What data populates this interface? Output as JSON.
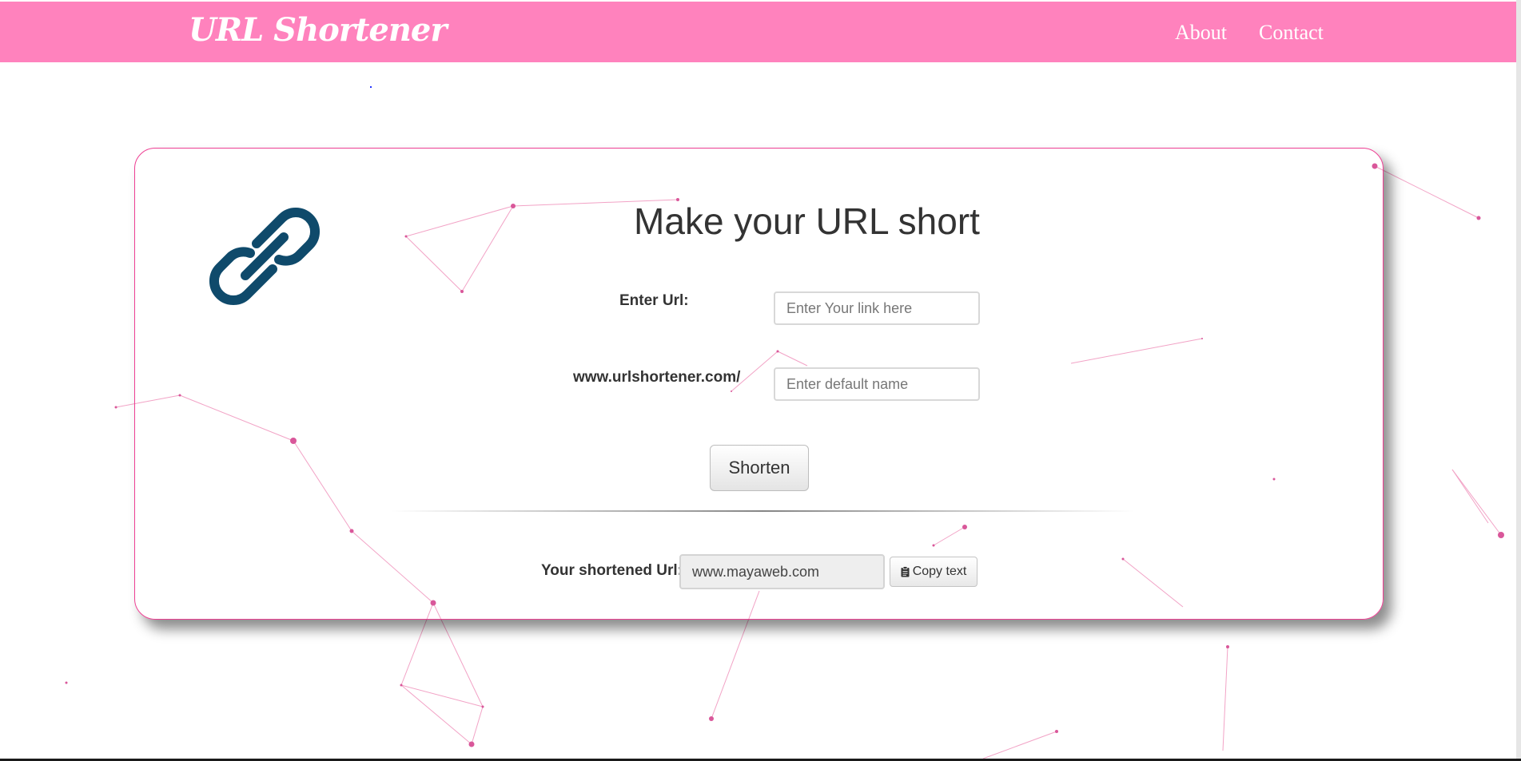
{
  "navbar": {
    "brand": "URL Shortener",
    "links": [
      {
        "label": "About"
      },
      {
        "label": "Contact"
      }
    ],
    "color": "#ff82bd"
  },
  "card": {
    "border_color": "#ee3f93",
    "icon": "link-chain-icon",
    "icon_color": "#0f4a6b",
    "title": "Make your URL short",
    "url_label": "Enter Url:",
    "url_placeholder": "Enter Your link here",
    "domain_label": "www.urlshortener.com/",
    "name_placeholder": "Enter default name",
    "shorten_label": "Shorten",
    "result_label": "Your shortened Url:",
    "result_value": "www.mayaweb.com",
    "copy_label": "Copy text",
    "copy_icon": "clipboard-icon"
  },
  "background": {
    "style": "particle-network",
    "line_color": "#f2a3c6",
    "dot_color": "#d9579a"
  }
}
